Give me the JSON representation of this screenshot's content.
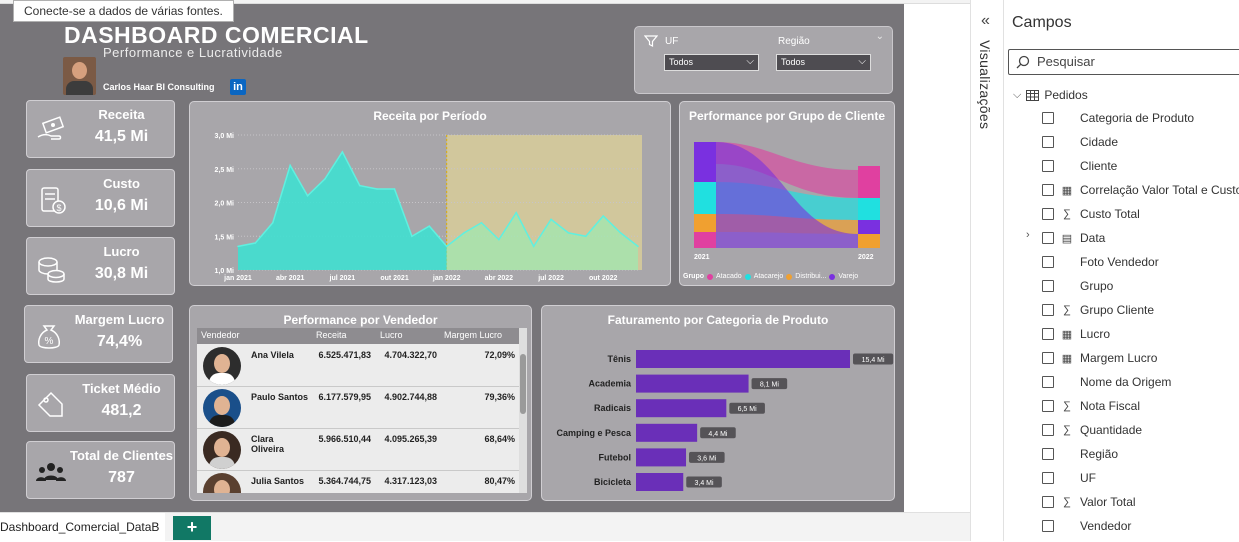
{
  "tooltip": "Conecte-se a dados de várias fontes.",
  "header": {
    "title": "DASHBOARD COMERCIAL",
    "subtitle": "Performance e Lucratividade",
    "author": "Carlos Haar BI Consulting",
    "linkedin": "in"
  },
  "filters": {
    "uf_label": "UF",
    "uf_value": "Todos",
    "regiao_label": "Região",
    "regiao_value": "Todos"
  },
  "cards": [
    {
      "label": "Receita",
      "value": "41,5 Mi",
      "icon": "money-hand-icon"
    },
    {
      "label": "Custo",
      "value": "10,6 Mi",
      "icon": "invoice-icon"
    },
    {
      "label": "Lucro",
      "value": "30,8 Mi",
      "icon": "coins-icon"
    },
    {
      "label": "Margem Lucro",
      "value": "74,4%",
      "icon": "percent-bag-icon"
    },
    {
      "label": "Ticket Médio",
      "value": "481,2",
      "icon": "price-tag-icon"
    },
    {
      "label": "Total de Clientes",
      "value": "787",
      "icon": "users-icon"
    }
  ],
  "receita_chart": {
    "title": "Receita por Período",
    "yticks": [
      "3,0 Mi",
      "2,5 Mi",
      "2,0 Mi",
      "1,5 Mi",
      "1,0 Mi"
    ],
    "xticks": [
      "jan 2021",
      "abr 2021",
      "jul 2021",
      "out 2021",
      "jan 2022",
      "abr 2022",
      "jul 2022",
      "out 2022"
    ]
  },
  "grupo_chart": {
    "title": "Performance por Grupo de Cliente",
    "years": [
      "2021",
      "2022"
    ],
    "legend_title": "Grupo",
    "legend": [
      {
        "name": "Atacado",
        "color": "#e040a0"
      },
      {
        "name": "Atacarejo",
        "color": "#20e0e0"
      },
      {
        "name": "Distribui...",
        "color": "#f0a030"
      },
      {
        "name": "Varejo",
        "color": "#7a30e0"
      }
    ]
  },
  "vendedor_table": {
    "title": "Performance por Vendedor",
    "columns": [
      "Vendedor",
      "Receita",
      "Lucro",
      "Margem Lucro"
    ],
    "rows": [
      {
        "name": "Ana Vilela",
        "receita": "6.525.471,83",
        "lucro": "4.704.322,70",
        "margem": "72,09%"
      },
      {
        "name": "Paulo Santos",
        "receita": "6.177.579,95",
        "lucro": "4.902.744,88",
        "margem": "79,36%"
      },
      {
        "name": "Clara Oliveira",
        "receita": "5.966.510,44",
        "lucro": "4.095.265,39",
        "margem": "68,64%"
      },
      {
        "name": "Julia Santos",
        "receita": "5.364.744,75",
        "lucro": "4.317.123,03",
        "margem": "80,47%"
      }
    ]
  },
  "categoria_chart": {
    "title": "Faturamento por Categoria de Produto",
    "bar_color": "#6a2fb8"
  },
  "chart_data": [
    {
      "type": "area",
      "title": "Receita por Período",
      "x": [
        "jan 2021",
        "fev 2021",
        "mar 2021",
        "abr 2021",
        "mai 2021",
        "jun 2021",
        "jul 2021",
        "ago 2021",
        "set 2021",
        "out 2021",
        "nov 2021",
        "dez 2021",
        "jan 2022",
        "fev 2022",
        "mar 2022",
        "abr 2022",
        "mai 2022",
        "jun 2022",
        "jul 2022",
        "ago 2022",
        "set 2022",
        "out 2022",
        "nov 2022",
        "dez 2022"
      ],
      "series": [
        {
          "values": [
            1.35,
            1.4,
            1.7,
            2.55,
            2.1,
            2.35,
            2.75,
            2.25,
            2.2,
            2.2,
            1.5,
            1.65,
            1.35,
            1.55,
            1.7,
            1.45,
            1.85,
            1.35,
            1.75,
            1.55,
            1.5,
            1.8,
            1.55,
            1.35
          ]
        }
      ],
      "ylim": [
        1.0,
        3.0
      ],
      "highlight_from": "jan 2022"
    },
    {
      "type": "bar",
      "title": "Faturamento por Categoria de Produto",
      "categories": [
        "Tênis",
        "Academia",
        "Radicais",
        "Camping e Pesca",
        "Futebol",
        "Bicicleta"
      ],
      "values": [
        15.4,
        8.1,
        6.5,
        4.4,
        3.6,
        3.4
      ],
      "labels": [
        "15,4 Mi",
        "8,1 Mi",
        "6,5 Mi",
        "4,4 Mi",
        "3,6 Mi",
        "3,4 Mi"
      ],
      "orientation": "horizontal"
    }
  ],
  "tabs": {
    "active": "Dashboard_Comercial_DataB",
    "add": "+"
  },
  "viz_pane": {
    "collapse": "«",
    "label": "Visualizações"
  },
  "fields_pane": {
    "title": "Campos",
    "search_placeholder": "Pesquisar",
    "table": "Pedidos",
    "fields": [
      {
        "name": "Categoria de Produto",
        "type": ""
      },
      {
        "name": "Cidade",
        "type": ""
      },
      {
        "name": "Cliente",
        "type": ""
      },
      {
        "name": "Correlação Valor Total e Custo",
        "type": "calc"
      },
      {
        "name": "Custo Total",
        "type": "sum"
      },
      {
        "name": "Data",
        "type": "date"
      },
      {
        "name": "Foto Vendedor",
        "type": ""
      },
      {
        "name": "Grupo",
        "type": ""
      },
      {
        "name": "Grupo Cliente",
        "type": "sum"
      },
      {
        "name": "Lucro",
        "type": "calc"
      },
      {
        "name": "Margem Lucro",
        "type": "calc"
      },
      {
        "name": "Nome da Origem",
        "type": ""
      },
      {
        "name": "Nota Fiscal",
        "type": "sum"
      },
      {
        "name": "Quantidade",
        "type": "sum"
      },
      {
        "name": "Região",
        "type": ""
      },
      {
        "name": "UF",
        "type": ""
      },
      {
        "name": "Valor Total",
        "type": "sum"
      },
      {
        "name": "Vendedor",
        "type": ""
      }
    ]
  }
}
